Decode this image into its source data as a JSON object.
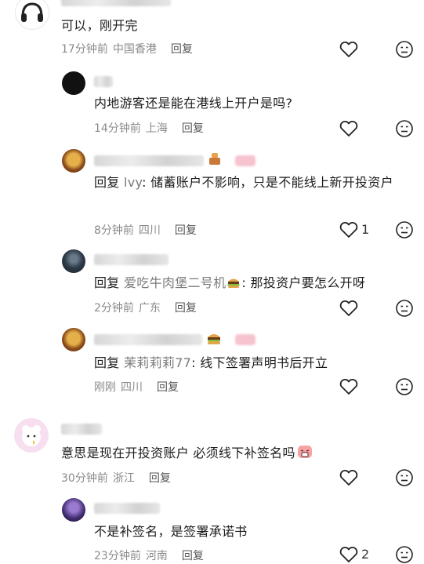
{
  "comments": [
    {
      "text": "可以，刚开完",
      "time": "17分钟前",
      "location": "中国香港",
      "reply_label": "回复"
    },
    {
      "text": "内地游客还是能在港线上开户是吗?",
      "time": "14分钟前",
      "location": "上海",
      "reply_label": "回复"
    },
    {
      "reply_prefix": "回复",
      "reply_to": "lvy",
      "text": ": 储蓄账户不影响，只是不能线上新开投资户",
      "time": "8分钟前",
      "location": "四川",
      "reply_label": "回复",
      "likes": "1"
    },
    {
      "reply_prefix": "回复",
      "reply_to": "爱吃牛肉堡二号机",
      "text": ": 那投资户要怎么开呀",
      "time": "2分钟前",
      "location": "广东",
      "reply_label": "回复"
    },
    {
      "reply_prefix": "回复",
      "reply_to": "茉莉莉莉77",
      "text": ": 线下签署声明书后开立",
      "time": "刚刚",
      "location": "四川",
      "reply_label": "回复"
    },
    {
      "text": "意思是现在开投资账户 必须线下补签名吗",
      "time": "30分钟前",
      "location": "浙江",
      "reply_label": "回复"
    },
    {
      "text": "不是补签名，是签署承诺书",
      "time": "23分钟前",
      "location": "河南",
      "reply_label": "回复",
      "likes": "2"
    }
  ],
  "icons": {
    "like": "heart-outline-icon",
    "dislike": "unhappy-face-icon"
  }
}
